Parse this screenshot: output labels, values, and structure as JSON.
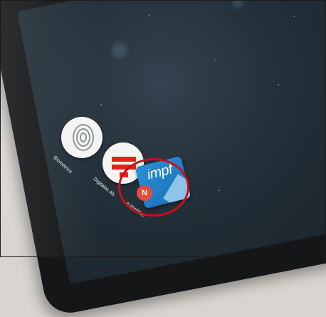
{
  "apps": [
    {
      "name": "Biometrics",
      "icon": "fingerprint-icon"
    },
    {
      "name": "Digitales Ab",
      "icon": "red-stripes-logo-icon"
    },
    {
      "name": "e-Impfdoc",
      "icon": "impf-logo-icon",
      "logo_text": "impf",
      "badge_text": "N"
    }
  ],
  "colors": {
    "screen_background": "#233039",
    "highlight_circle": "#c81018",
    "impf_blue": "#1b6fb8",
    "badge_red": "#e64b3c",
    "stripe_red": "#e3241b"
  }
}
